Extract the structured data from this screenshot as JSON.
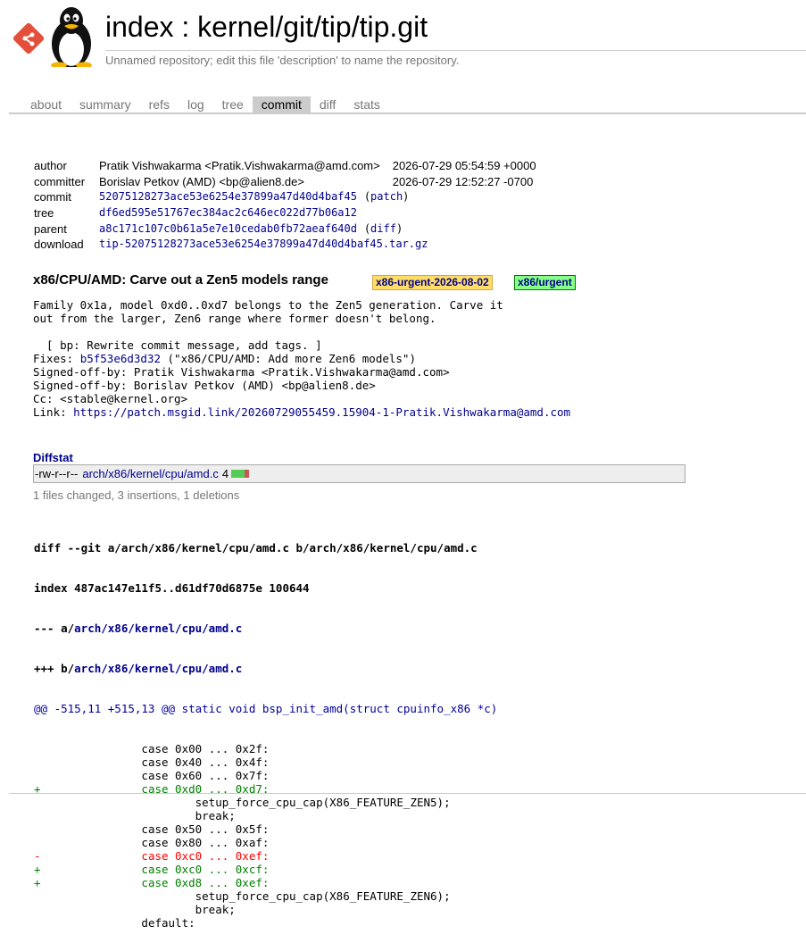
{
  "header": {
    "title": "index : kernel/git/tip/tip.git",
    "description": "Unnamed repository; edit this file 'description' to name the repository."
  },
  "tabs": [
    "about",
    "summary",
    "refs",
    "log",
    "tree",
    "commit",
    "diff",
    "stats"
  ],
  "active_tab": "commit",
  "commit_info": {
    "author_label": "author",
    "author": "Pratik Vishwakarma <Pratik.Vishwakarma@amd.com>",
    "author_date": "2026-07-29 05:54:59 +0000",
    "committer_label": "committer",
    "committer": "Borislav Petkov (AMD) <bp@alien8.de>",
    "committer_date": "2026-07-29 12:52:27 -0700",
    "commit_label": "commit",
    "commit_hash": "52075128273ace53e6254e37899a47d40d4baf45",
    "commit_patch": "patch",
    "tree_label": "tree",
    "tree_hash": "df6ed595e51767ec384ac2c646ec022d77b06a12",
    "parent_label": "parent",
    "parent_hash": "a8c171c107c0b61a5e7e10cedab0fb72aeaf640d",
    "parent_diff": "diff",
    "download_label": "download",
    "download_file": "tip-52075128273ace53e6254e37899a47d40d4baf45.tar.gz"
  },
  "subject": {
    "text": "x86/CPU/AMD: Carve out a Zen5 models range",
    "tags": [
      "x86-urgent-2026-08-02",
      "x86/urgent"
    ]
  },
  "message": {
    "body": "Family 0x1a, model 0xd0..0xd7 belongs to the Zen5 generation. Carve it\nout from the larger, Zen6 range where former doesn't belong.\n\n  [ bp: Rewrite commit message, add tags. ]\n",
    "fixes_prefix": "Fixes: ",
    "fixes_hash": "b5f53e6d3d32",
    "fixes_rest": " (\"x86/CPU/AMD: Add more Zen6 models\")",
    "trailers": "Signed-off-by: Pratik Vishwakarma <Pratik.Vishwakarma@amd.com>\nSigned-off-by: Borislav Petkov (AMD) <bp@alien8.de>\nCc: <stable@kernel.org>",
    "link_prefix": "Link: ",
    "link_url": "https://patch.msgid.link/20260729055459.15904-1-Pratik.Vishwakarma@amd.com"
  },
  "diffstat": {
    "header": "Diffstat",
    "mode": "-rw-r--r--",
    "file": "arch/x86/kernel/cpu/amd.c",
    "count": "4",
    "insertions": 3,
    "deletions": 1,
    "summary": "1 files changed, 3 insertions, 1 deletions"
  },
  "diff": {
    "header_lines": [
      "diff --git a/arch/x86/kernel/cpu/amd.c b/arch/x86/kernel/cpu/amd.c",
      "index 487ac147e11f5..d61df70d6875e 100644"
    ],
    "minus_prefix": "--- a/",
    "plus_prefix": "+++ b/",
    "file_path": "arch/x86/kernel/cpu/amd.c",
    "hunk_header": "@@ -515,11 +515,13 @@ static void bsp_init_amd(struct cpuinfo_x86 *c)",
    "lines": [
      {
        "type": "ctx",
        "text": " \t\tcase 0x00 ... 0x2f:"
      },
      {
        "type": "ctx",
        "text": " \t\tcase 0x40 ... 0x4f:"
      },
      {
        "type": "ctx",
        "text": " \t\tcase 0x60 ... 0x7f:"
      },
      {
        "type": "add",
        "text": "+\t\tcase 0xd0 ... 0xd7:"
      },
      {
        "type": "ctx",
        "text": " \t\t\tsetup_force_cpu_cap(X86_FEATURE_ZEN5);"
      },
      {
        "type": "ctx",
        "text": " \t\t\tbreak;"
      },
      {
        "type": "ctx",
        "text": " \t\tcase 0x50 ... 0x5f:"
      },
      {
        "type": "ctx",
        "text": " \t\tcase 0x80 ... 0xaf:"
      },
      {
        "type": "del",
        "text": "-\t\tcase 0xc0 ... 0xef:"
      },
      {
        "type": "add",
        "text": "+\t\tcase 0xc0 ... 0xcf:"
      },
      {
        "type": "add",
        "text": "+\t\tcase 0xd8 ... 0xef:"
      },
      {
        "type": "ctx",
        "text": " \t\t\tsetup_force_cpu_cap(X86_FEATURE_ZEN6);"
      },
      {
        "type": "ctx",
        "text": " \t\t\tbreak;"
      },
      {
        "type": "ctx",
        "text": " \t\tdefault:"
      }
    ]
  },
  "icons": {
    "logo": "git-tux-logo-icon"
  },
  "colors": {
    "link": "#00008b",
    "tag_release_bg": "#ffdd66",
    "tag_branch_bg": "#88ff88",
    "diff_add": "#008000",
    "diff_del": "#ff0000",
    "diff_hunk": "#000099"
  }
}
